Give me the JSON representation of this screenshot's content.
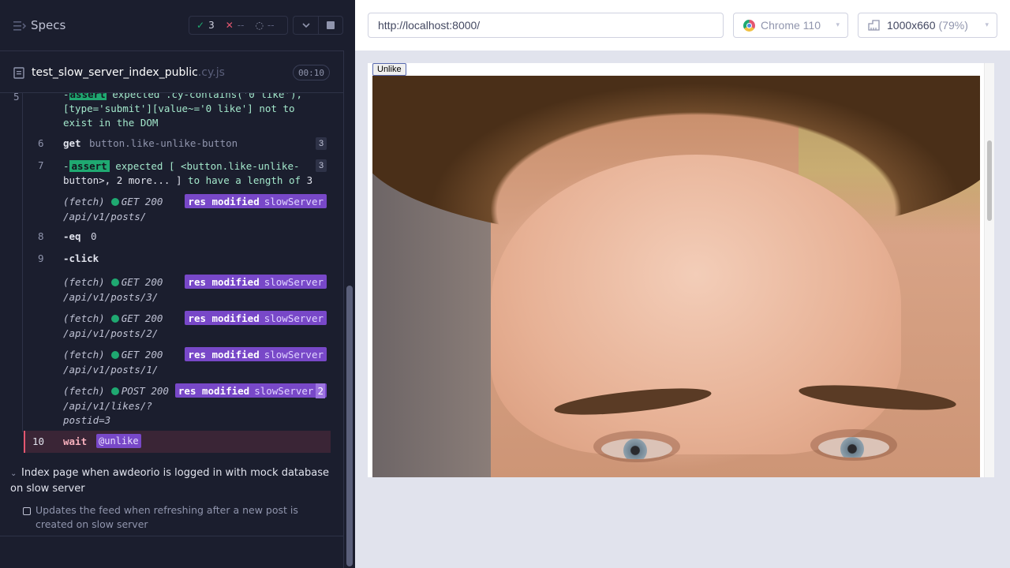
{
  "reporter": {
    "title": "Specs",
    "stats": {
      "passed": "3",
      "failed": "--",
      "pending": "--"
    },
    "spec": {
      "name": "test_slow_server_index_public",
      "ext": ".cy.js",
      "duration": "00:10"
    },
    "commands": [
      {
        "num": "5",
        "line1": "-assert expected .cy-contains('0 like'),",
        "line2": "[type='submit'][value~='0 like'] not to",
        "line3": "exist in the DOM"
      },
      {
        "num": "6",
        "name": "get",
        "msg": "button.like-unlike-button",
        "count": "3"
      },
      {
        "num": "7",
        "name": "-assert",
        "msg1": "expected [ <button.like-unlike-",
        "msg2": "button>, 2 more... ]",
        "msg2b": "to have a length of",
        "msg2c": "3",
        "count": "3"
      },
      {
        "num": "8",
        "name": "-eq",
        "msg": "0"
      },
      {
        "num": "9",
        "name": "-click"
      },
      {
        "num": "10",
        "name": "wait",
        "alias": "@unlike"
      }
    ],
    "fetches": [
      {
        "label": "(fetch)",
        "method": "GET 200",
        "url": "/api/v1/posts/",
        "mod": "res modified",
        "alias": "slowServer"
      },
      {
        "label": "(fetch)",
        "method": "GET 200",
        "url": "/api/v1/posts/3/",
        "mod": "res modified",
        "alias": "slowServer"
      },
      {
        "label": "(fetch)",
        "method": "GET 200",
        "url": "/api/v1/posts/2/",
        "mod": "res modified",
        "alias": "slowServer"
      },
      {
        "label": "(fetch)",
        "method": "GET 200",
        "url": "/api/v1/posts/1/",
        "mod": "res modified",
        "alias": "slowServer"
      },
      {
        "label": "(fetch)",
        "method": "POST 200",
        "url": "/api/v1/likes/?",
        "url2": "postid=3",
        "mod": "res modified",
        "alias": "slowServer",
        "count": "2"
      }
    ],
    "suite": "Index page when awdeorio is logged in with mock database on slow server",
    "test": "Updates the feed when refreshing after a new post is created on slow server"
  },
  "aut": {
    "url": "http://localhost:8000/",
    "browser": "Chrome 110",
    "viewport": "1000x660",
    "viewport_pct": "(79%)",
    "unlike_label": "Unlike"
  },
  "colors": {
    "pass": "#1fa971",
    "fail": "#e45770",
    "alias": "#7848c8",
    "panel": "#1b1e2e"
  }
}
